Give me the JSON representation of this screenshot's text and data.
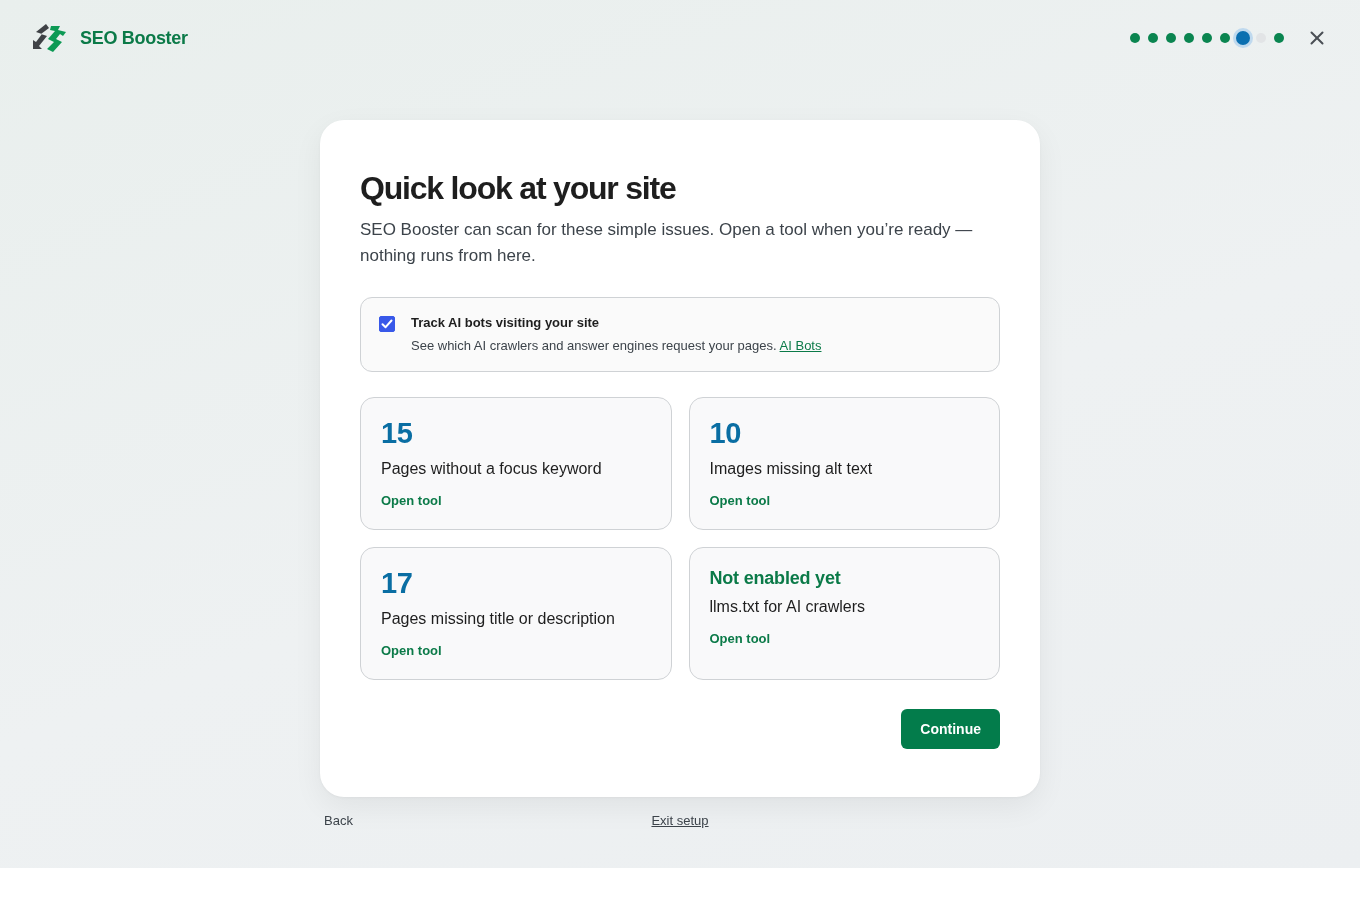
{
  "brand": {
    "name": "SEO Booster"
  },
  "progress": {
    "steps": [
      {
        "kind": "done"
      },
      {
        "kind": "done"
      },
      {
        "kind": "done"
      },
      {
        "kind": "done"
      },
      {
        "kind": "done"
      },
      {
        "kind": "done"
      },
      {
        "kind": "current"
      },
      {
        "kind": "pending"
      },
      {
        "kind": "done"
      }
    ]
  },
  "dialog": {
    "title": "Quick look at your site",
    "subtitle": "SEO Booster can scan for these simple issues. Open a tool when you’re ready — nothing runs from here.",
    "option": {
      "label": "Track AI bots visiting your site",
      "description": "See which AI crawlers and answer engines request your pages.",
      "link": "AI Bots",
      "checked": true
    },
    "stats": [
      {
        "kind": "count",
        "value": "15",
        "label": "Pages without a focus keyword",
        "action": "Open tool"
      },
      {
        "kind": "count",
        "value": "10",
        "label": "Images missing alt text",
        "action": "Open tool"
      },
      {
        "kind": "count",
        "value": "17",
        "label": "Pages missing title or description",
        "action": "Open tool"
      },
      {
        "kind": "status",
        "value": "Not enabled yet",
        "label": "llms.txt for AI crawlers",
        "action": "Open tool"
      }
    ],
    "primary_button": "Continue"
  },
  "footer": {
    "back": "Back",
    "exit": "Exit setup"
  }
}
